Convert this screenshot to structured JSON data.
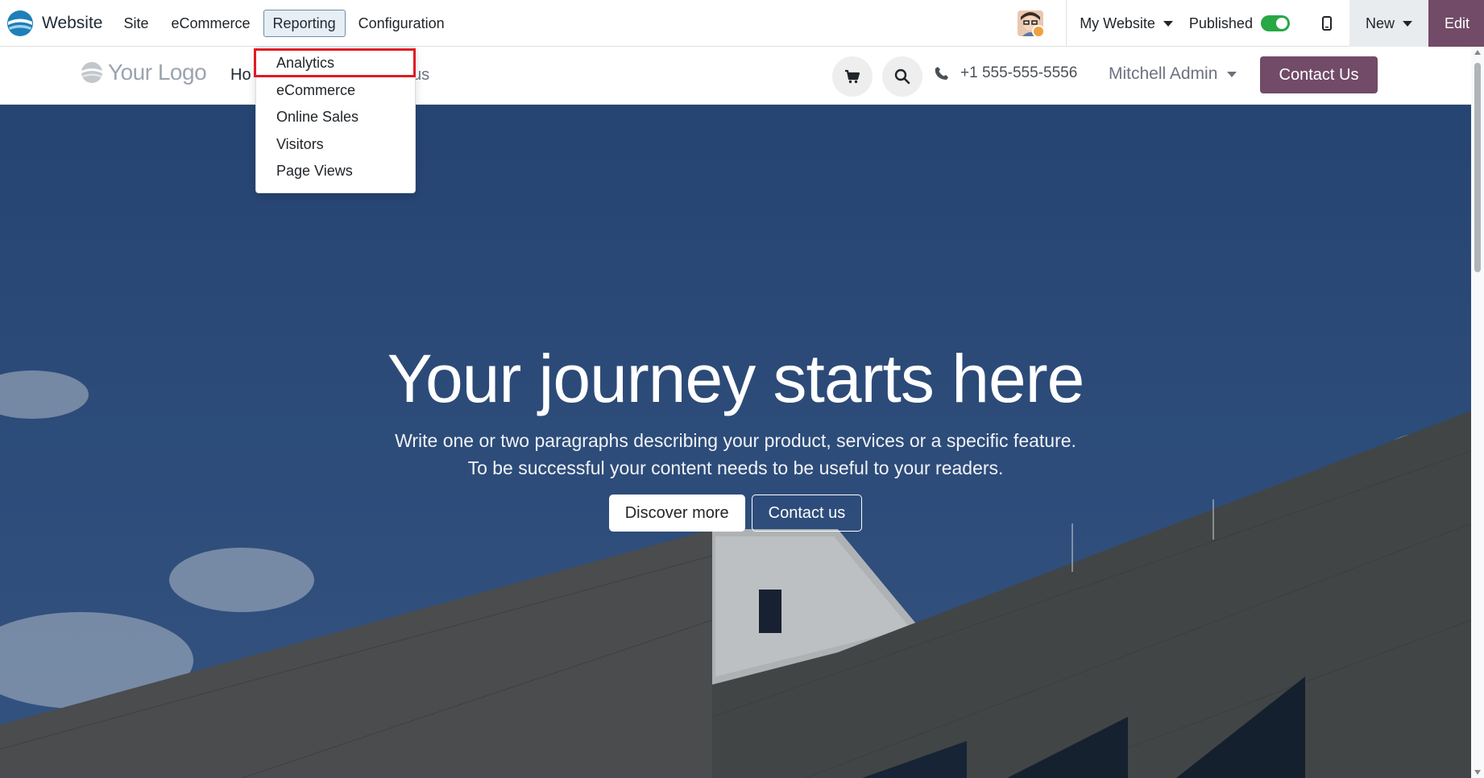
{
  "topbar": {
    "app_name": "Website",
    "menu": [
      {
        "label": "Site"
      },
      {
        "label": "eCommerce"
      },
      {
        "label": "Reporting"
      },
      {
        "label": "Configuration"
      }
    ],
    "site_selector": "My Website",
    "published_label": "Published",
    "published": true,
    "new_label": "New",
    "edit_label": "Edit"
  },
  "reporting_dropdown": {
    "items": [
      {
        "label": "Analytics"
      },
      {
        "label": "eCommerce"
      },
      {
        "label": "Online Sales"
      },
      {
        "label": "Visitors"
      },
      {
        "label": "Page Views"
      }
    ]
  },
  "site_header": {
    "logo_text": "Your Logo",
    "nav_home_visible": "Ho",
    "nav_clipped_visible": "us",
    "phone": "+1 555-555-5556",
    "user": "Mitchell Admin",
    "contact_button": "Contact Us"
  },
  "hero": {
    "title": "Your journey starts here",
    "text_line1": "Write one or two paragraphs describing your product, services or a specific feature.",
    "text_line2": "To be successful your content needs to be useful to your readers.",
    "discover_button": "Discover more",
    "contact_button": "Contact us"
  },
  "colors": {
    "brand": "#714b67",
    "toggle_on": "#28a745",
    "highlight": "#e01b24",
    "hero_sky": "#2c4a78"
  }
}
